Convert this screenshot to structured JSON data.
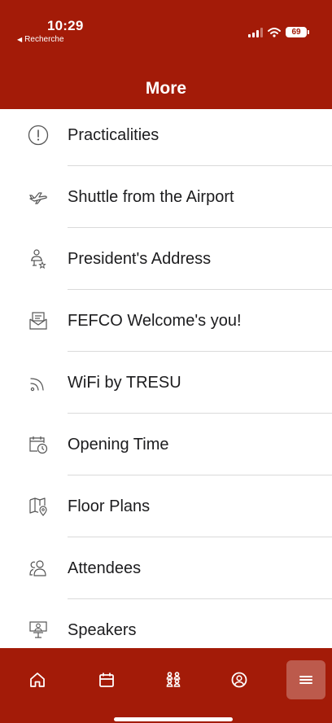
{
  "status_bar": {
    "time": "10:29",
    "back_app": "Recherche",
    "battery": "69"
  },
  "header": {
    "title": "More"
  },
  "menu": {
    "items": [
      {
        "label": "Practicalities",
        "icon": "info-exclamation-icon"
      },
      {
        "label": "Shuttle from the Airport",
        "icon": "airplane-icon"
      },
      {
        "label": "President's Address",
        "icon": "person-award-icon"
      },
      {
        "label": "FEFCO Welcome's you!",
        "icon": "envelope-icon"
      },
      {
        "label": "WiFi by TRESU",
        "icon": "wifi-signal-icon"
      },
      {
        "label": "Opening Time",
        "icon": "calendar-clock-icon"
      },
      {
        "label": "Floor Plans",
        "icon": "map-pin-icon"
      },
      {
        "label": "Attendees",
        "icon": "people-icon"
      },
      {
        "label": "Speakers",
        "icon": "speaker-podium-icon"
      }
    ]
  },
  "tab_bar": {
    "tabs": [
      {
        "icon": "home-icon",
        "active": false
      },
      {
        "icon": "calendar-icon",
        "active": false
      },
      {
        "icon": "group-icon",
        "active": false
      },
      {
        "icon": "profile-icon",
        "active": false
      },
      {
        "icon": "menu-icon",
        "active": true
      }
    ]
  },
  "colors": {
    "brand": "#a31b08",
    "divider": "#dadada"
  }
}
